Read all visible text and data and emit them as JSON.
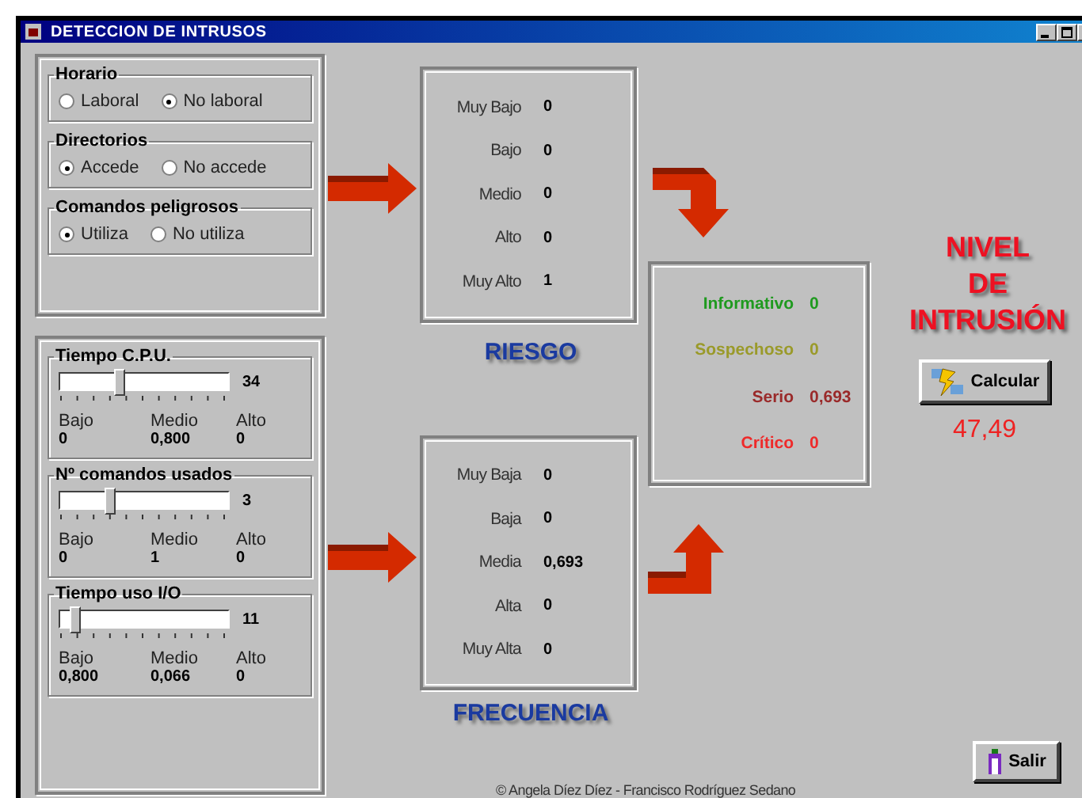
{
  "window": {
    "title": "DETECCION DE INTRUSOS"
  },
  "radio_groups": [
    {
      "label": "Horario",
      "options": [
        {
          "label": "Laboral",
          "selected": false
        },
        {
          "label": "No laboral",
          "selected": true
        }
      ]
    },
    {
      "label": "Directorios",
      "options": [
        {
          "label": "Accede",
          "selected": true
        },
        {
          "label": "No accede",
          "selected": false
        }
      ]
    },
    {
      "label": "Comandos peligrosos",
      "options": [
        {
          "label": "Utiliza",
          "selected": true
        },
        {
          "label": "No utiliza",
          "selected": false
        }
      ]
    }
  ],
  "sliders": [
    {
      "label": "Tiempo C.P.U.",
      "value": "34",
      "level": 0.34,
      "readings": [
        {
          "label": "Bajo",
          "value": "0"
        },
        {
          "label": "Medio",
          "value": "0,800"
        },
        {
          "label": "Alto",
          "value": "0"
        }
      ]
    },
    {
      "label": "Nº comandos usados",
      "value": "3",
      "level": 0.28,
      "readings": [
        {
          "label": "Bajo",
          "value": "0"
        },
        {
          "label": "Medio",
          "value": "1"
        },
        {
          "label": "Alto",
          "value": "0"
        }
      ]
    },
    {
      "label": "Tiempo uso I/O",
      "value": "11",
      "level": 0.06,
      "readings": [
        {
          "label": "Bajo",
          "value": "0,800"
        },
        {
          "label": "Medio",
          "value": "0,066"
        },
        {
          "label": "Alto",
          "value": "0"
        }
      ]
    }
  ],
  "riesgo": {
    "title": "RIESGO",
    "rows": [
      {
        "label": "Muy Bajo",
        "value": "0"
      },
      {
        "label": "Bajo",
        "value": "0"
      },
      {
        "label": "Medio",
        "value": "0"
      },
      {
        "label": "Alto",
        "value": "0"
      },
      {
        "label": "Muy Alto",
        "value": "1"
      }
    ]
  },
  "frecuencia": {
    "title": "FRECUENCIA",
    "rows": [
      {
        "label": "Muy Baja",
        "value": "0"
      },
      {
        "label": "Baja",
        "value": "0"
      },
      {
        "label": "Media",
        "value": "0,693"
      },
      {
        "label": "Alta",
        "value": "0"
      },
      {
        "label": "Muy Alta",
        "value": "0"
      }
    ]
  },
  "nivel": {
    "rows": [
      {
        "label": "Informativo",
        "value": "0",
        "color": "#1f9a1f"
      },
      {
        "label": "Sospechoso",
        "value": "0",
        "color": "#9a9a2a"
      },
      {
        "label": "Serio",
        "value": "0,693",
        "color": "#9a2a2a"
      },
      {
        "label": "Crítico",
        "value": "0",
        "color": "#ee2a2a"
      }
    ]
  },
  "heading": [
    "NIVEL",
    "DE",
    "INTRUSIÓN"
  ],
  "calculate_button": "Calcular",
  "result": "47,49",
  "exit_button": "Salir",
  "footer": "©  Angela Díez Díez - Francisco Rodríguez Sedano"
}
